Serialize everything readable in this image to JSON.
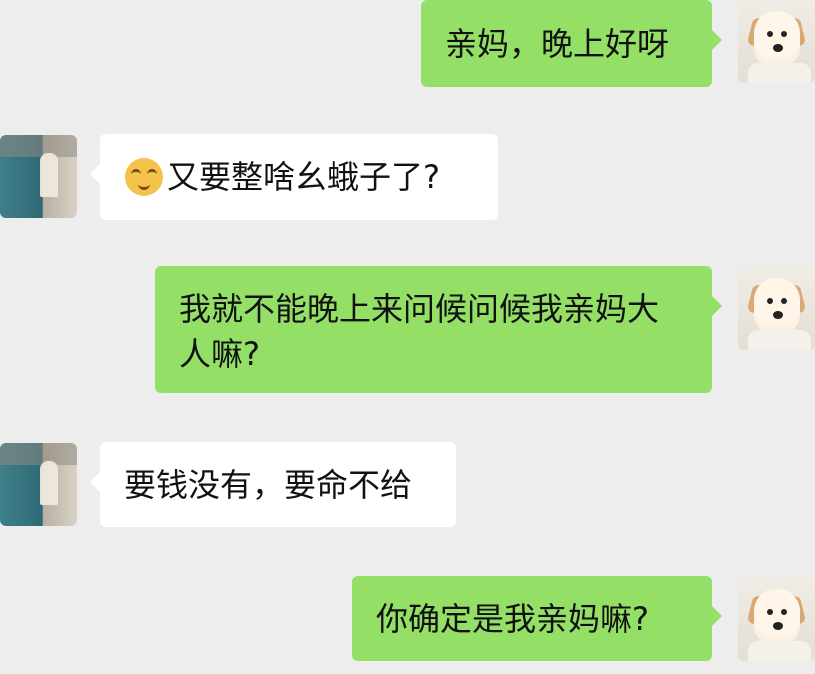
{
  "chat": {
    "messages": [
      {
        "sender": "self",
        "text": "亲妈，晚上好呀"
      },
      {
        "sender": "mom",
        "emoji": "face-icon",
        "text": "又要整啥幺蛾子了?"
      },
      {
        "sender": "self",
        "text": "我就不能晚上来问候问候我亲妈大人嘛?"
      },
      {
        "sender": "mom",
        "text": "要钱没有，要命不给"
      },
      {
        "sender": "self",
        "text": "你确定是我亲妈嘛?"
      }
    ]
  }
}
